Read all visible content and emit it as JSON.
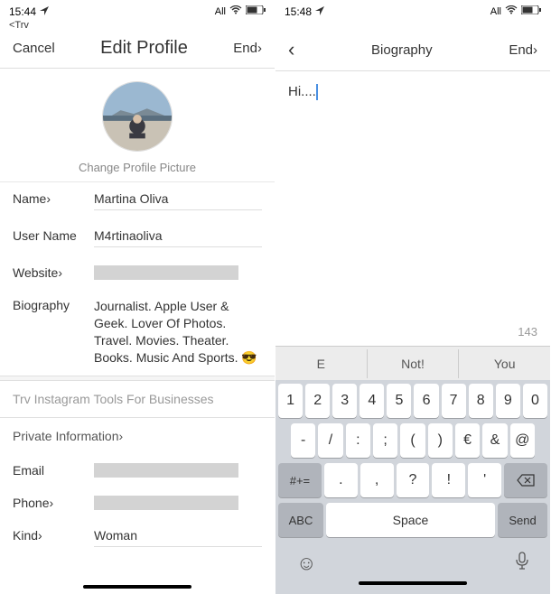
{
  "left": {
    "status": {
      "time": "15:44",
      "right_text": "All"
    },
    "try": "<Trv",
    "nav": {
      "cancel": "Cancel",
      "title": "Edit Profile",
      "done": "End›"
    },
    "change_pic": "Change Profile Picture",
    "fields": {
      "name_label": "Name›",
      "name_value": "Martina Oliva",
      "username_label": "User Name",
      "username_value": "M4rtinaoliva",
      "website_label": "Website›",
      "bio_label": "Biography",
      "bio_value": "Journalist. Apple User & Geek. Lover Of Photos. Travel. Movies. Theater. Books. Music And Sports. 😎"
    },
    "biz": "Trv Instagram Tools For Businesses",
    "private_hdr": "Private Information›",
    "email_label": "Email",
    "phone_label": "Phone›",
    "kind_label": "Kind›",
    "kind_value": "Woman"
  },
  "right": {
    "status": {
      "time": "15:48",
      "right_text": "All"
    },
    "nav": {
      "title": "Biography",
      "done": "End›"
    },
    "compose_text": "Hi....",
    "char_count": "143",
    "suggestions": [
      "E",
      "Not!",
      "You"
    ],
    "row1": [
      "1",
      "2",
      "3",
      "4",
      "5",
      "6",
      "7",
      "8",
      "9",
      "0"
    ],
    "row2": [
      "-",
      "/",
      ":",
      ";",
      "(",
      ")",
      "€",
      "&",
      "@"
    ],
    "row3_shift": "#+=",
    "row3": [
      ".",
      ",",
      "?",
      "!",
      "'"
    ],
    "abc": "ABC",
    "space": "Space",
    "send": "Send"
  }
}
